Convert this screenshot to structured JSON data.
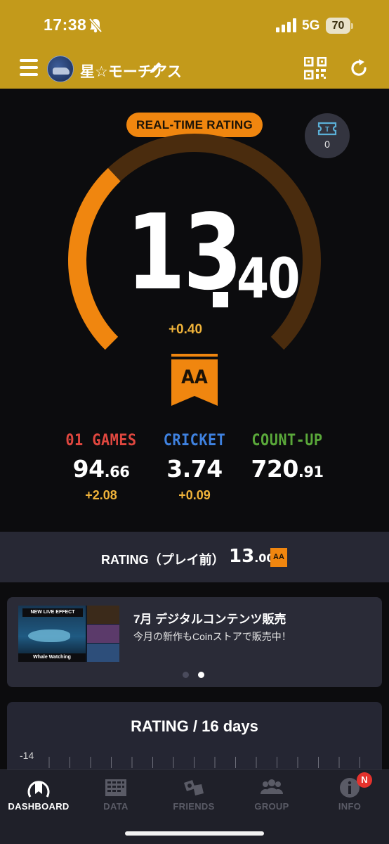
{
  "status_bar": {
    "time": "17:38",
    "network": "5G",
    "battery": "70"
  },
  "app_bar": {
    "username": "星☆モーチアス"
  },
  "rating": {
    "badge_label": "REAL-TIME RATING",
    "ticket_count": "0",
    "integer": "13",
    "decimal": "40",
    "delta": "+0.40",
    "rank": "AA",
    "gauge_progress": 0.34
  },
  "categories": [
    {
      "label": "01 GAMES",
      "value_int": "94",
      "value_dec": ".66",
      "delta": "+2.08",
      "color": "#e0473f"
    },
    {
      "label": "CRICKET",
      "value_int": "3.74",
      "value_dec": "",
      "delta": "+0.09",
      "color": "#3f82e0"
    },
    {
      "label": "COUNT-UP",
      "value_int": "720",
      "value_dec": ".91",
      "delta": "",
      "color": "#5aa83a"
    }
  ],
  "pre_play": {
    "label": "RATING（プレイ前）",
    "value_int": "13",
    "value_dec": ".00",
    "rank": "AA"
  },
  "banner": {
    "title": "7月 デジタルコンテンツ販売",
    "subtitle": "今月の新作もCoinストアで販売中！",
    "thumb_title": "NEW LIVE EFFECT",
    "thumb_subtitle": "Whale Watching",
    "active_dot": 1
  },
  "chart_card": {
    "title": "RATING / 16 days",
    "first_tick": "-14"
  },
  "bottom_nav": {
    "items": [
      {
        "label": "DASHBOARD",
        "icon": "dashboard-icon",
        "active": true
      },
      {
        "label": "DATA",
        "icon": "data-icon",
        "active": false
      },
      {
        "label": "FRIENDS",
        "icon": "friends-icon",
        "active": false
      },
      {
        "label": "GROUP",
        "icon": "group-icon",
        "active": false
      },
      {
        "label": "INFO",
        "icon": "info-icon",
        "active": false
      }
    ],
    "info_badge": "N"
  },
  "colors": {
    "header": "#c39a1b",
    "accent": "#f0860f",
    "gauge_track": "#4a2c0e",
    "delta": "#f0b33a"
  }
}
